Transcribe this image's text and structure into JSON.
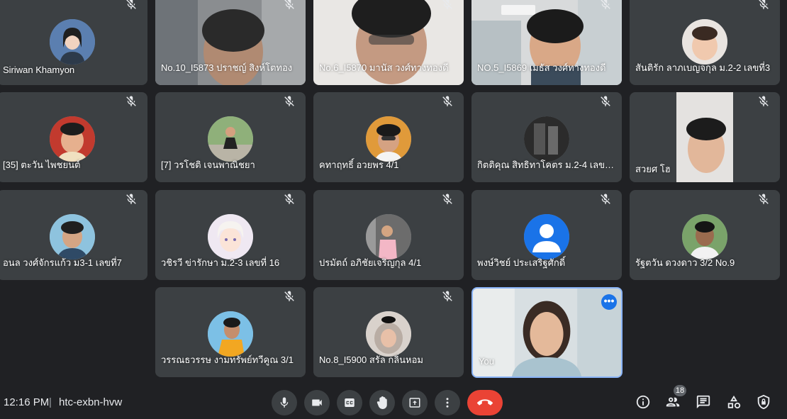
{
  "participants": [
    {
      "name": "Siriwan Khamyon",
      "type": "avatar"
    },
    {
      "name": "No.10_I5873 ปราชญ์ สิงห์โตทอง",
      "type": "video"
    },
    {
      "name": "No.6_I5870 มานัส วงศ์ทางทองดี",
      "type": "video"
    },
    {
      "name": "NO.5_I5869 เมธัส วงศ์ทางทองดี",
      "type": "video"
    },
    {
      "name": "สันติรัก ลาภเบญจกุล ม.2-2 เลขที่3",
      "type": "avatar"
    },
    {
      "name": "[35] ตะวัน ไพชยนต์",
      "type": "avatar"
    },
    {
      "name": "[7] วรโชติ เจนพาณิชยา",
      "type": "avatar"
    },
    {
      "name": "คทาฤทธิ์ อวยพร 4/1",
      "type": "avatar"
    },
    {
      "name": "กิตติคุณ สิทธิทาโคตร ม.2-4 เลขที่ ...",
      "type": "avatar"
    },
    {
      "name": "สวยศ โฮ",
      "type": "video"
    },
    {
      "name": "อนล วงศ์จักรแก้ว ม3-1 เลขที่7",
      "type": "avatar"
    },
    {
      "name": "วชิรวี ข่ารักษา ม.2-3 เลขที่ 16",
      "type": "avatar"
    },
    {
      "name": "ปรมัตถ์ อภิชัยเจริญกุล 4/1",
      "type": "avatar"
    },
    {
      "name": "พงษ์วิชย์ ประเสริฐศักดิ์",
      "type": "default-avatar"
    },
    {
      "name": "รัฐตวัน ดวงดาว 3/2 No.9",
      "type": "avatar"
    },
    {
      "name": "วรรณธวรรษ งามทรัพย์ทวีคูณ 3/1",
      "type": "avatar"
    },
    {
      "name": "No.8_I5900 สรัล กลิ่นหอม",
      "type": "avatar"
    },
    {
      "name": "You",
      "type": "self-video"
    }
  ],
  "meeting": {
    "time": "12:16 PM",
    "separator": "|",
    "code": "htc-exbn-hvw",
    "participant_count": "18"
  },
  "controls": {
    "microphone_icon": "microphone-icon",
    "camera_icon": "camera-icon",
    "captions_icon": "captions-icon",
    "raise_hand_icon": "hand-icon",
    "present_icon": "present-screen-icon",
    "more_icon": "more-vert-icon",
    "end_call_icon": "end-call-icon",
    "info_icon": "info-icon",
    "people_icon": "people-icon",
    "chat_icon": "chat-icon",
    "activities_icon": "activities-icon",
    "host_controls_icon": "shield-lock-icon"
  },
  "colors": {
    "background": "#202124",
    "tile": "#3c4043",
    "end_call": "#ea4335",
    "self_border": "#8ab4f8",
    "more_button": "#1a73e8"
  }
}
